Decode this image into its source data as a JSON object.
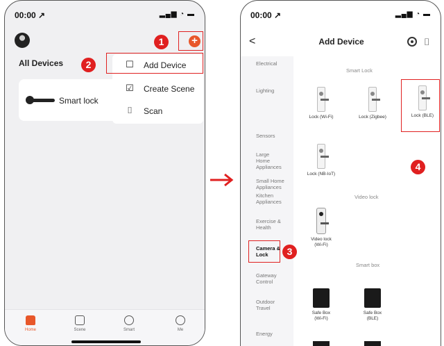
{
  "left": {
    "status_time": "00:00 ↗",
    "status_icons": "▂▄▆ ◔ ▬",
    "all_devices": "All Devices",
    "device_name": "Smart lock",
    "plus_symbol": "+",
    "menu": [
      {
        "label": "Add Device",
        "icon": "add-device-icon",
        "glyph": "☐"
      },
      {
        "label": "Create Scene",
        "icon": "create-scene-icon",
        "glyph": "☑"
      },
      {
        "label": "Scan",
        "icon": "scan-icon",
        "glyph": "⌷"
      }
    ],
    "tabs": [
      {
        "label": "Home",
        "icon": "home-icon",
        "active": true
      },
      {
        "label": "Scene",
        "icon": "scene-icon"
      },
      {
        "label": "Smart",
        "icon": "smart-icon"
      },
      {
        "label": "Me",
        "icon": "me-icon"
      }
    ]
  },
  "right": {
    "status_time": "00:00 ↗",
    "status_icons": "▂▄▆ ◔ ▬",
    "back_symbol": "<",
    "title": "Add Device",
    "scan_symbol": "⌷",
    "categories": [
      "Electrical",
      "Lighting",
      "Sensors",
      "Large Home Appliances",
      "Small Home Appliances",
      "Kitchen Appliances",
      "Exercise & Health",
      "Camera & Lock",
      "Gateway Control",
      "Outdoor Travel",
      "Energy"
    ],
    "selected_category": "Camera & Lock",
    "sections": {
      "smart_lock": "Smart Lock",
      "video_lock": "Video lock",
      "smart_box": "Smart box"
    },
    "items": {
      "lock_wifi": "Lock (Wi-Fi)",
      "lock_zigbee": "Lock (Zigbee)",
      "lock_ble": "Lock (BLE)",
      "lock_nbiot": "Lock (NB-IoT)",
      "video_lock_wifi": "Video lock (Wi-Fi)",
      "safe_box_wifi": "Safe Box (Wi-Fi)",
      "safe_box_ble": "Safe Box (BLE)"
    }
  },
  "callouts": [
    "1",
    "2",
    "3",
    "4"
  ],
  "colors": {
    "accent": "#e8572a",
    "callout": "#e02020"
  }
}
